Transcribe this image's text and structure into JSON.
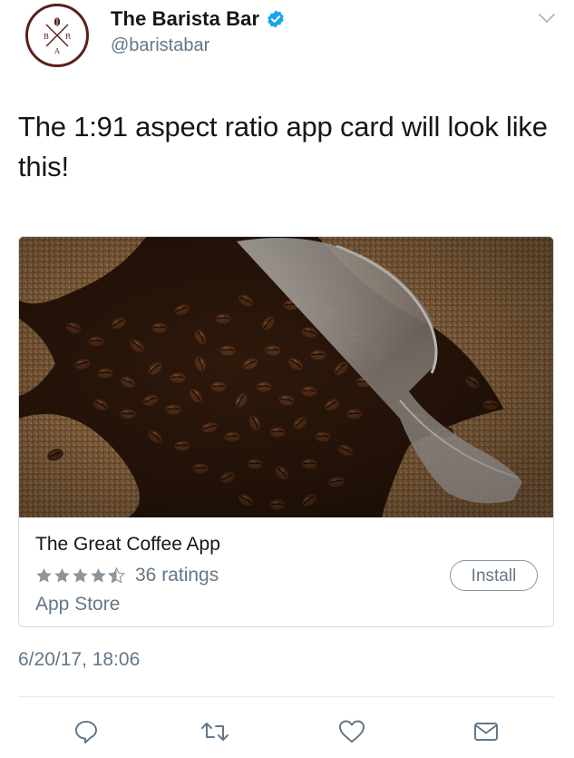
{
  "tweet": {
    "author": {
      "display_name": "The Barista Bar",
      "handle": "@baristabar",
      "verified": true,
      "avatar_logo_letters": [
        "B",
        "R",
        "A"
      ],
      "avatar_icon": "coffee-bean-cross-logo"
    },
    "menu_icon": "chevron-down-icon",
    "text": "The 1:91 aspect ratio app card will look like this!",
    "card": {
      "image_description_icon": "coffee-beans-photo",
      "app_title": "The Great Coffee App",
      "rating_stars": 4.5,
      "ratings_text": "36 ratings",
      "store": "App Store",
      "install_label": "Install"
    },
    "timestamp": "6/20/17, 18:06",
    "actions": [
      {
        "name": "reply",
        "icon": "reply-icon"
      },
      {
        "name": "retweet",
        "icon": "retweet-icon"
      },
      {
        "name": "like",
        "icon": "heart-icon"
      },
      {
        "name": "direct-message",
        "icon": "envelope-icon"
      }
    ]
  },
  "colors": {
    "verified_blue": "#1da1f2",
    "secondary_text": "#657786",
    "primary_text": "#14171a",
    "avatar_border": "#5a1f1c",
    "star_gray": "#8a959e"
  }
}
